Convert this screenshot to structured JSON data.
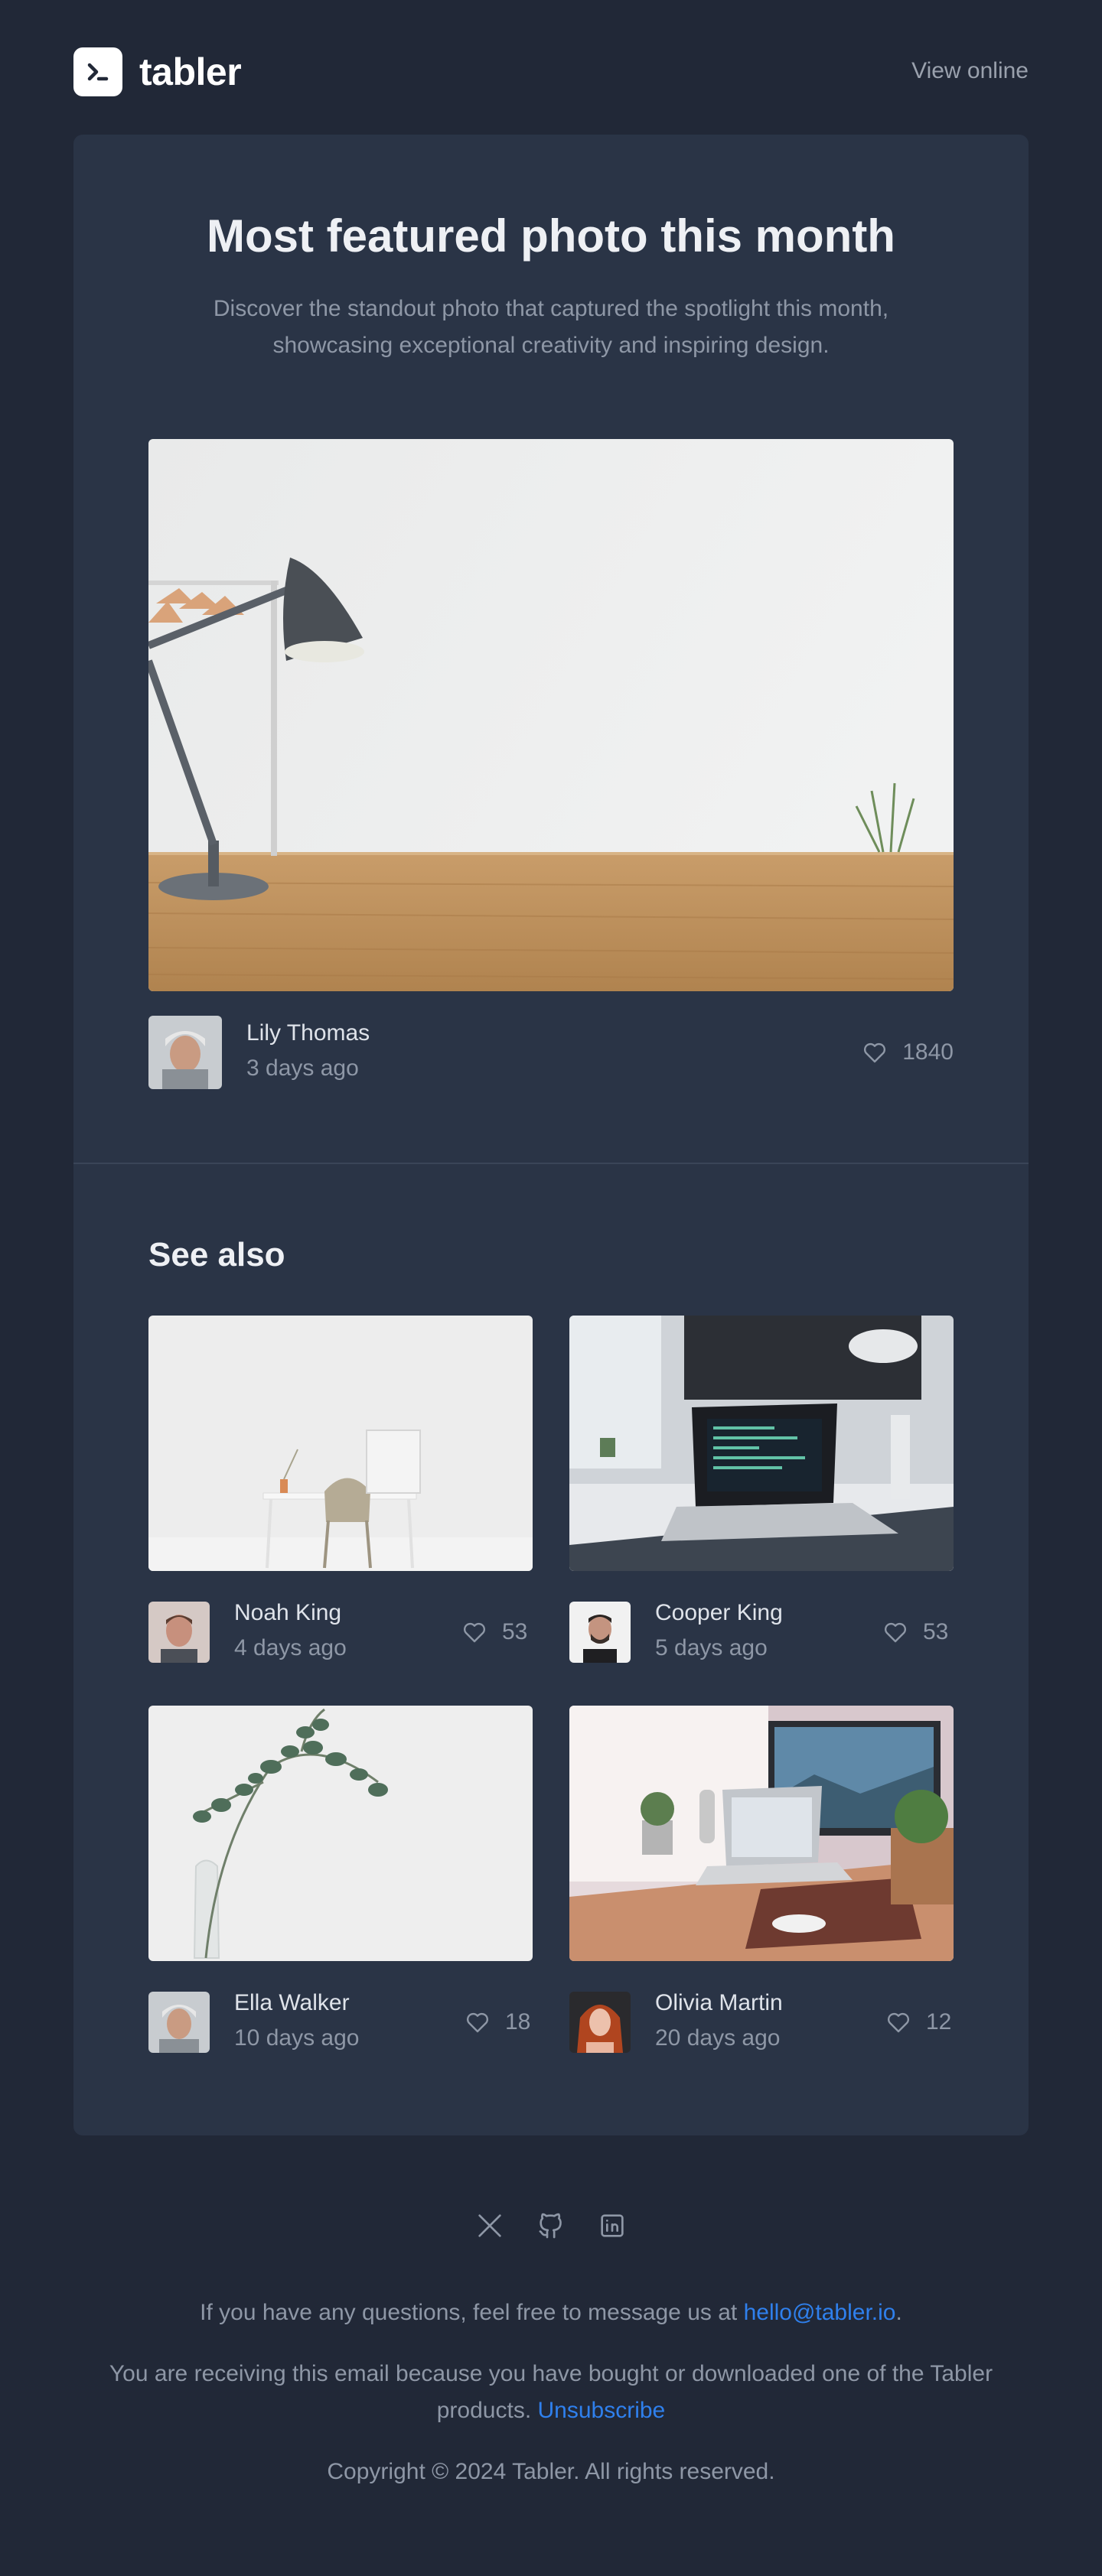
{
  "header": {
    "logo_text": "tabler",
    "view_online": "View online"
  },
  "hero": {
    "title": "Most featured photo this month",
    "description": "Discover the standout photo that captured the spotlight this month, showcasing exceptional creativity and inspiring design."
  },
  "featured": {
    "author": "Lily Thomas",
    "date": "3 days ago",
    "likes": "1840"
  },
  "see_also": {
    "title": "See also",
    "items": [
      {
        "author": "Noah King",
        "date": "4 days ago",
        "likes": "53"
      },
      {
        "author": "Cooper King",
        "date": "5 days ago",
        "likes": "53"
      },
      {
        "author": "Ella Walker",
        "date": "10 days ago",
        "likes": "18"
      },
      {
        "author": "Olivia Martin",
        "date": "20 days ago",
        "likes": "12"
      }
    ]
  },
  "footer": {
    "social_icons": [
      "x-icon",
      "github-icon",
      "linkedin-icon"
    ],
    "questions_text": "If you have any questions, feel free to message us at ",
    "email": "hello@tabler.io",
    "questions_end": ".",
    "receiving_text": "You are receiving this email because you have bought or downloaded one of the Tabler products. ",
    "unsubscribe": "Unsubscribe",
    "copyright": "Copyright © 2024 Tabler. All rights reserved."
  },
  "colors": {
    "background": "#212837",
    "card": "#2a3446",
    "link": "#2f80ed",
    "muted_text": "#8e97a6"
  }
}
